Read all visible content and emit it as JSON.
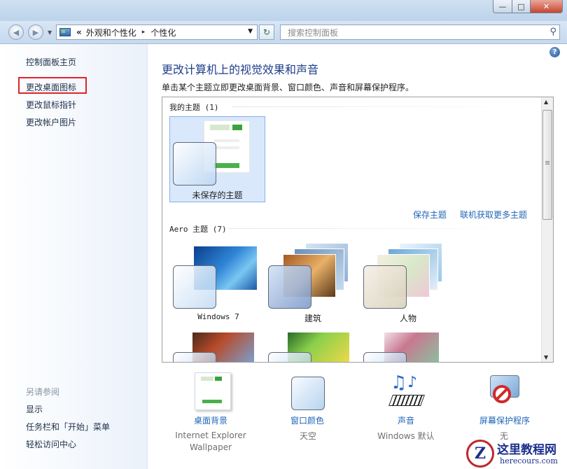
{
  "window": {
    "buttons": {
      "minimize": "—",
      "maximize": "□",
      "close": "✕"
    }
  },
  "nav": {
    "back_icon": "back-arrow-icon",
    "forward_icon": "forward-arrow-icon",
    "breadcrumb": {
      "overflow": "«",
      "items": [
        "外观和个性化",
        "个性化"
      ],
      "separator": "▸"
    },
    "search_placeholder": "搜索控制面板"
  },
  "sidebar": {
    "links": [
      "控制面板主页",
      "更改桌面图标",
      "更改鼠标指针",
      "更改帐户图片"
    ],
    "highlighted_index": 1,
    "see_also_title": "另请参阅",
    "see_also": [
      "显示",
      "任务栏和「开始」菜单",
      "轻松访问中心"
    ]
  },
  "main": {
    "heading": "更改计算机上的视觉效果和声音",
    "description": "单击某个主题立即更改桌面背景、窗口颜色、声音和屏幕保护程序。",
    "my_themes": {
      "title": "我的主题 (1)",
      "unsaved_label": "未保存的主题",
      "save_link": "保存主题",
      "online_link": "联机获取更多主题"
    },
    "aero_themes": {
      "title": "Aero 主题 (7)",
      "items": [
        "Windows 7",
        "建筑",
        "人物"
      ]
    },
    "bottom": [
      {
        "label": "桌面背景",
        "sub": "Internet Explorer Wallpaper"
      },
      {
        "label": "窗口颜色",
        "sub": "天空"
      },
      {
        "label": "声音",
        "sub": "Windows 默认"
      },
      {
        "label": "屏幕保护程序",
        "sub": "无"
      }
    ]
  },
  "watermark": {
    "title": "这里教程网",
    "url": "herecours.com",
    "letter": "Z"
  },
  "colors": {
    "heading": "#1e3d8a",
    "link": "#1f66b8",
    "highlight_box": "#e0242c",
    "selected_tile": "#d9e8fb"
  }
}
